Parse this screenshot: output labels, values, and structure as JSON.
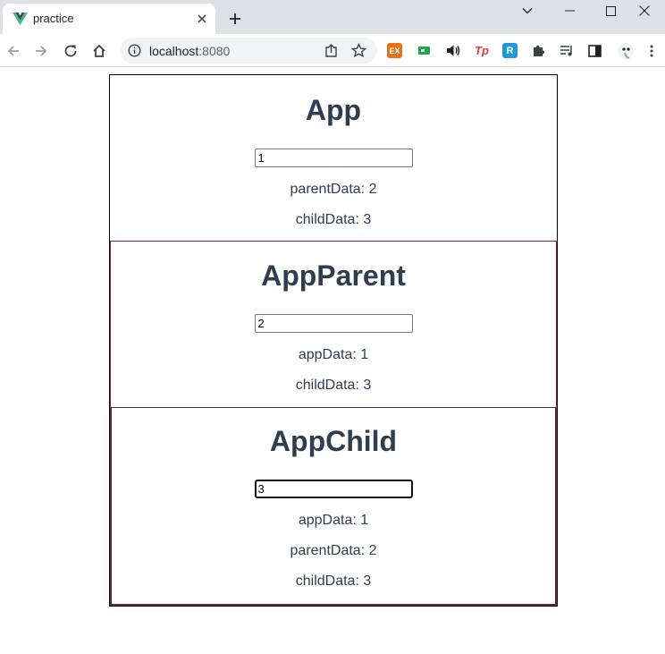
{
  "browser": {
    "tab_title": "practice",
    "url_host": "localhost",
    "url_port": ":8080",
    "icons": {
      "favicon": "vue-logo-icon",
      "close": "close-icon",
      "new_tab": "plus-icon",
      "back": "arrow-left-icon",
      "forward": "arrow-right-icon",
      "reload": "reload-icon",
      "home": "home-icon",
      "info": "info-icon",
      "share": "share-icon",
      "bookmark": "star-icon"
    },
    "extensions": [
      {
        "name": "ex-extension-icon",
        "label": "EX",
        "color": "#e8711c"
      },
      {
        "name": "green-extension-icon",
        "label": "",
        "color": "#1fa74a"
      },
      {
        "name": "speaker-extension-icon",
        "label": "",
        "color": "#202124"
      },
      {
        "name": "tp-extension-icon",
        "label": "Tp",
        "color": "#e53935"
      },
      {
        "name": "r-extension-icon",
        "label": "R",
        "color": "#1e9bd7"
      }
    ]
  },
  "app": {
    "title": "App",
    "input_value": "1",
    "lines": [
      "parentData: 2",
      "childData: 3"
    ]
  },
  "parent": {
    "title": "AppParent",
    "input_value": "2",
    "lines": [
      "appData: 1",
      "childData: 3"
    ]
  },
  "child": {
    "title": "AppChild",
    "input_value": "3",
    "lines": [
      "appData: 1",
      "parentData: 2",
      "childData: 3"
    ]
  },
  "colors": {
    "heading": "#2c3e50",
    "app_border": "#000000",
    "parent_border": "#8b1a3a",
    "child_border": "#2b2b8c"
  }
}
